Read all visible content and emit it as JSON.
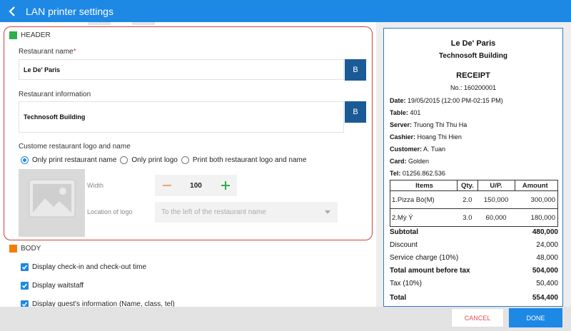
{
  "app": {
    "title": "LAN printer settings"
  },
  "header_section": {
    "title": "HEADER",
    "restaurant_name_label": "Restaurant name",
    "required_mark": "*",
    "restaurant_name_value": "Le De' Paris",
    "restaurant_info_label": "Restaurant information",
    "restaurant_info_value": "Technosoft Building",
    "bold_button_label": "B",
    "logo_section_label": "Custome restaurant logo and name",
    "radio_options": [
      {
        "label": "Only print restaurant name",
        "selected": true
      },
      {
        "label": "Only print logo",
        "selected": false
      },
      {
        "label": "Print both restaurant logo and name",
        "selected": false
      }
    ],
    "width_label": "Width",
    "width_value": "100",
    "location_label": "Location of logo",
    "location_value": "To the left of the restaurant name"
  },
  "body_section": {
    "title": "BODY",
    "checkboxes": [
      {
        "label": "Display check-in and check-out time",
        "checked": true
      },
      {
        "label": "Display waitstaff",
        "checked": true
      },
      {
        "label": "Display guest's information (Name, class, tel)",
        "checked": true
      }
    ]
  },
  "receipt": {
    "restaurant_name": "Le De' Paris",
    "restaurant_info": "Technosoft Building",
    "title": "RECEIPT",
    "number": "No.: 160200001",
    "date_label": "Date:",
    "date_value": "19/05/2015 (12:00 PM-02:15 PM)",
    "table_label": "Table:",
    "table_value": "401",
    "server_label": "Server:",
    "server_value": "Truong Thi Thu Ha",
    "cashier_label": "Cashier:",
    "cashier_value": "Hoang Thi Hien",
    "customer_label": "Customer:",
    "customer_value": "A. Tuan",
    "card_label": "Card:",
    "card_value": "Golden",
    "tel_label": "Tel:",
    "tel_value": "01256.862.536",
    "table_headers": [
      "Items",
      "Qty.",
      "U/P.",
      "Amount"
    ],
    "items": [
      {
        "name": "1.Pizza Bò(M)",
        "qty": "2.0",
        "unit_price": "150,000",
        "amount": "300,000"
      },
      {
        "name": "2.Mỳ Ý",
        "qty": "3.0",
        "unit_price": "60,000",
        "amount": "180,000"
      }
    ],
    "subtotal_label": "Subtotal",
    "subtotal_value": "480,000",
    "discount_label": "Discount",
    "discount_value": "24,000",
    "service_label": "Service charge (10%)",
    "service_value": "48,000",
    "before_tax_label": "Total amount before tax",
    "before_tax_value": "504,000",
    "tax_label": "Tax (10%)",
    "tax_value": "50,400",
    "total_label": "Total",
    "total_value": "554,400"
  },
  "footer": {
    "cancel_label": "CANCEL",
    "done_label": "DONE"
  },
  "colors": {
    "primary": "#1e88e5",
    "header_marker": "#2db04a",
    "body_marker": "#f57c00",
    "bold_button": "#1a5a96",
    "highlight_border": "#d04040"
  }
}
